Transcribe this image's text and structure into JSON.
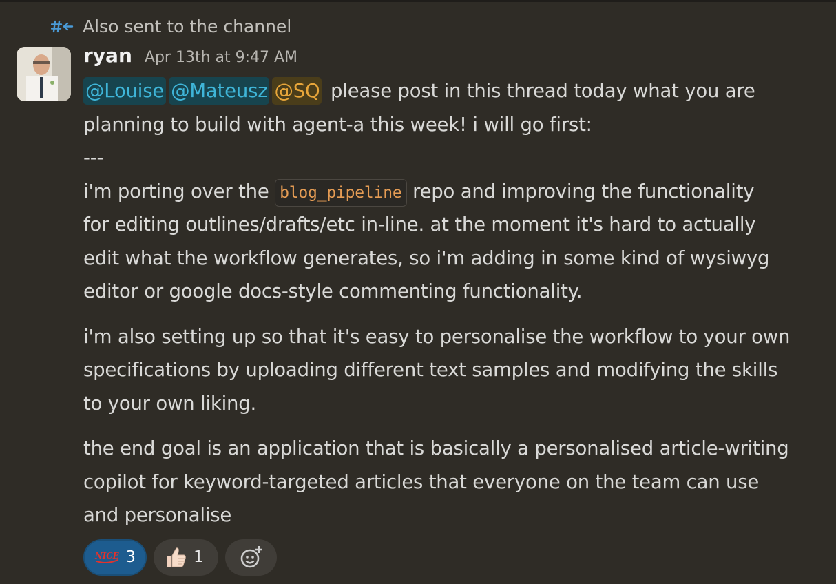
{
  "thread": {
    "note": "Also sent to the channel"
  },
  "message": {
    "author": "ryan",
    "timestamp": "Apr 13th at 9:47 AM",
    "mentions": [
      "@Louise",
      "@Mateusz",
      "@SQ"
    ],
    "line1_rest": " please post in this thread today what you are",
    "line2": "planning to build with agent-a this week! i will go first:",
    "separator": "---",
    "p1_pre": "i'm porting over the ",
    "p1_code": "blog_pipeline",
    "p1_post": " repo and improving the functionality",
    "p1_l2": "for editing outlines/drafts/etc in-line. at the moment it's hard to actually",
    "p1_l3": "edit what the workflow generates, so i'm adding in some kind of wysiwyg",
    "p1_l4": "editor or google docs-style commenting functionality.",
    "p2_l1": "i'm also setting up so that it's easy to personalise the workflow to your own",
    "p2_l2": "specifications by uploading different text samples and modifying the skills",
    "p2_l3": "to your own liking.",
    "p3_l1": "the end goal is an application that is basically a personalised article-writing",
    "p3_l2": "copilot for keyword-targeted articles that everyone on the team can use",
    "p3_l3": "and personalise"
  },
  "reactions": [
    {
      "icon": "nice-emoji-icon",
      "count": "3",
      "active": true
    },
    {
      "icon": "thumbs-up-icon",
      "count": "1",
      "active": false
    }
  ],
  "colors": {
    "background": "#2f2c26",
    "mention": "#3fb5d8",
    "mention_highlight": "#e8a63a",
    "code": "#e59c54",
    "active_reaction": "#1d5c8f"
  }
}
